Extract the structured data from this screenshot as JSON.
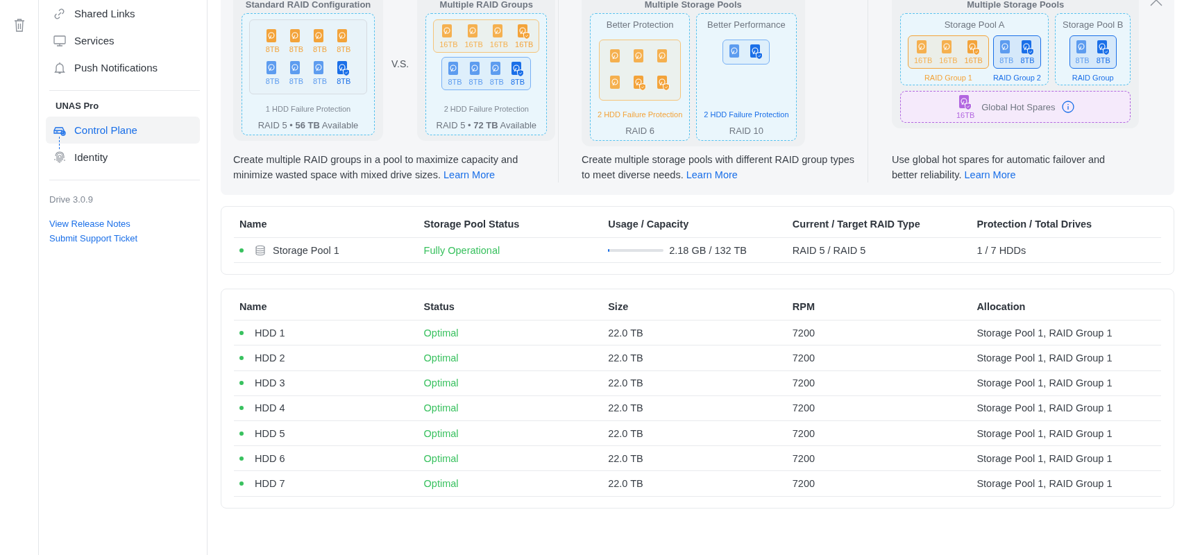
{
  "sidebar": {
    "items": [
      {
        "label": "Shared Links",
        "selected": false
      },
      {
        "label": "Services",
        "selected": false
      },
      {
        "label": "Push Notifications",
        "selected": false
      }
    ],
    "section": {
      "title": "UNAS Pro",
      "items": [
        {
          "label": "Control Plane",
          "selected": true
        },
        {
          "label": "Identity",
          "selected": false
        }
      ]
    },
    "version": "Drive 3.0.9",
    "links": [
      "View Release Notes",
      "Submit Support Ticket"
    ]
  },
  "banner": {
    "panels": [
      {
        "figures": [
          {
            "heading": "Standard RAID Configuration",
            "cards": [
              {
                "groups": [
                  {
                    "color": "#d6dbe1",
                    "drives": [
                      {
                        "color": "#f3a33a",
                        "size": "8TB",
                        "parity": false
                      },
                      {
                        "color": "#f3a33a",
                        "size": "8TB",
                        "parity": false
                      },
                      {
                        "color": "#f3a33a",
                        "size": "8TB",
                        "parity": false
                      },
                      {
                        "color": "#f3a33a",
                        "size": "8TB",
                        "parity": false
                      },
                      {
                        "color": "#5d9cef",
                        "size": "8TB",
                        "parity": false
                      },
                      {
                        "color": "#5d9cef",
                        "size": "8TB",
                        "parity": false
                      },
                      {
                        "color": "#5d9cef",
                        "size": "8TB",
                        "parity": false
                      },
                      {
                        "color": "#1a6fe8",
                        "size": "8TB",
                        "parity": true
                      }
                    ]
                  }
                ],
                "protection": {
                  "text": "1 HDD Failure Protection",
                  "color": "#808893"
                },
                "summary": "RAID 5 • **56 TB** Available"
              }
            ]
          },
          {
            "heading": "Multiple RAID Groups",
            "cards": [
              {
                "groups": [
                  {
                    "color": "#f6c47a",
                    "drives": [
                      {
                        "color": "#f5b04f",
                        "size": "16TB",
                        "parity": false
                      },
                      {
                        "color": "#f5b04f",
                        "size": "16TB",
                        "parity": false
                      },
                      {
                        "color": "#f5b04f",
                        "size": "16TB",
                        "parity": false
                      },
                      {
                        "color": "#f3a33a",
                        "size": "16TB",
                        "parity": true
                      }
                    ]
                  },
                  {
                    "color": "#78b0f5",
                    "drives": [
                      {
                        "color": "#5d9cef",
                        "size": "8TB",
                        "parity": false
                      },
                      {
                        "color": "#5d9cef",
                        "size": "8TB",
                        "parity": false
                      },
                      {
                        "color": "#5d9cef",
                        "size": "8TB",
                        "parity": false
                      },
                      {
                        "color": "#1a6fe8",
                        "size": "8TB",
                        "parity": true
                      }
                    ]
                  }
                ],
                "protection": {
                  "text": "2 HDD Failure Protection",
                  "color": "#808893"
                },
                "summary": "RAID 5 • **72 TB** Available"
              }
            ]
          }
        ],
        "separator": "V.S.",
        "description": "Create multiple RAID groups in a pool to maximize capacity and minimize wasted space with mixed drive sizes.",
        "link": "Learn More"
      },
      {
        "figures": [
          {
            "heading": "Multiple Storage Pools",
            "cards": [
              {
                "title": "Better Protection",
                "groups": [
                  {
                    "color": "#f6c47a",
                    "drives": [
                      {
                        "color": "#f5b04f",
                        "parity": false
                      },
                      {
                        "color": "#f5b04f",
                        "parity": false
                      },
                      {
                        "color": "#f5b04f",
                        "parity": false
                      },
                      {
                        "color": "#f5b04f",
                        "parity": false
                      },
                      {
                        "color": "#f3a33a",
                        "parity": true
                      },
                      {
                        "color": "#f3a33a",
                        "parity": true
                      }
                    ]
                  }
                ],
                "protection": {
                  "text": "2 HDD Failure Protection",
                  "color": "#f3a33a"
                },
                "summary": "RAID 6"
              },
              {
                "title": "Better Performance",
                "groups": [
                  {
                    "color": "#78b0f5",
                    "drives": [
                      {
                        "color": "#5d9cef",
                        "parity": false
                      },
                      {
                        "color": "#1a6fe8",
                        "parity": true
                      }
                    ]
                  }
                ],
                "protection": {
                  "text": "2 HDD Failure Protection",
                  "color": "#1a6fe8"
                },
                "summary": "RAID 10"
              }
            ]
          }
        ],
        "description": "Create multiple storage pools with different RAID group types to meet diverse needs.",
        "link": "Learn More"
      },
      {
        "figures": [
          {
            "heading": "Multiple Storage Pools",
            "cards": [
              {
                "title": "Storage Pool A",
                "groups": [
                  {
                    "color": "#f3a33a",
                    "label": "RAID Group 1",
                    "drives": [
                      {
                        "color": "#f5b04f",
                        "size": "16TB",
                        "parity": false
                      },
                      {
                        "color": "#f5b04f",
                        "size": "16TB",
                        "parity": false
                      },
                      {
                        "color": "#f3a33a",
                        "size": "16TB",
                        "parity": true
                      }
                    ]
                  },
                  {
                    "color": "#1a6fe8",
                    "label": "RAID Group 2",
                    "drives": [
                      {
                        "color": "#5d9cef",
                        "size": "8TB",
                        "parity": false
                      },
                      {
                        "color": "#1a6fe8",
                        "size": "8TB",
                        "parity": true
                      }
                    ]
                  }
                ]
              },
              {
                "title": "Storage Pool B",
                "groups": [
                  {
                    "color": "#1a6fe8",
                    "label": "RAID Group",
                    "drives": [
                      {
                        "color": "#5d9cef",
                        "size": "8TB",
                        "parity": false
                      },
                      {
                        "color": "#1a6fe8",
                        "size": "8TB",
                        "parity": true
                      }
                    ]
                  }
                ]
              }
            ],
            "spares": {
              "label": "Global Hot Spares",
              "drives": [
                {
                  "color": "#b266e0",
                  "size": "16TB",
                  "parity": true
                }
              ]
            }
          }
        ],
        "description": "Use global hot spares for automatic failover and better reliability.",
        "link": "Learn More"
      }
    ]
  },
  "pools": {
    "columns": [
      "Name",
      "Storage Pool Status",
      "Usage / Capacity",
      "Current / Target RAID Type",
      "Protection / Total Drives"
    ],
    "rows": [
      {
        "healthy": true,
        "name": "Storage Pool 1",
        "status": "Fully Operational",
        "usage": {
          "level": 0,
          "text": "2.18 GB / 132 TB"
        },
        "raid": "RAID 5 / RAID 5",
        "protection": "1 / 7 HDDs"
      }
    ]
  },
  "drives": {
    "columns": [
      "Name",
      "Status",
      "Size",
      "RPM",
      "Allocation"
    ],
    "rows": [
      {
        "healthy": true,
        "name": "HDD 1",
        "status": "Optimal",
        "size": "22.0 TB",
        "rpm": "7200",
        "allocation": "Storage Pool 1, RAID Group 1"
      },
      {
        "healthy": true,
        "name": "HDD 2",
        "status": "Optimal",
        "size": "22.0 TB",
        "rpm": "7200",
        "allocation": "Storage Pool 1, RAID Group 1"
      },
      {
        "healthy": true,
        "name": "HDD 3",
        "status": "Optimal",
        "size": "22.0 TB",
        "rpm": "7200",
        "allocation": "Storage Pool 1, RAID Group 1"
      },
      {
        "healthy": true,
        "name": "HDD 4",
        "status": "Optimal",
        "size": "22.0 TB",
        "rpm": "7200",
        "allocation": "Storage Pool 1, RAID Group 1"
      },
      {
        "healthy": true,
        "name": "HDD 5",
        "status": "Optimal",
        "size": "22.0 TB",
        "rpm": "7200",
        "allocation": "Storage Pool 1, RAID Group 1"
      },
      {
        "healthy": true,
        "name": "HDD 6",
        "status": "Optimal",
        "size": "22.0 TB",
        "rpm": "7200",
        "allocation": "Storage Pool 1, RAID Group 1"
      },
      {
        "healthy": true,
        "name": "HDD 7",
        "status": "Optimal",
        "size": "22.0 TB",
        "rpm": "7200",
        "allocation": "Storage Pool 1, RAID Group 1"
      }
    ]
  }
}
